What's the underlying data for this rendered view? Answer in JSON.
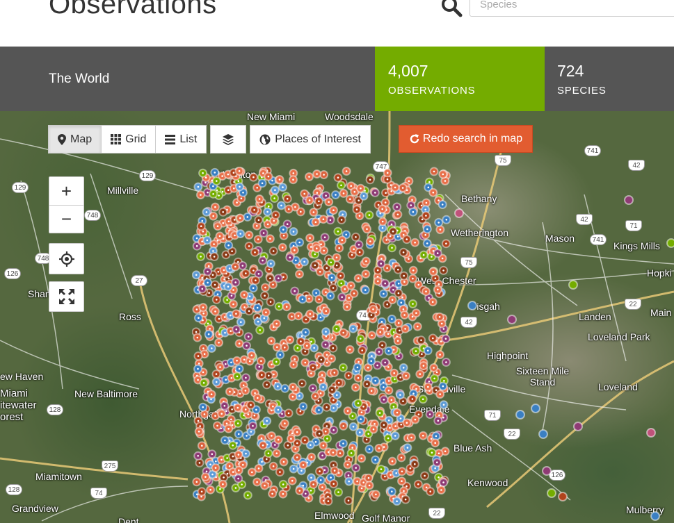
{
  "header": {
    "title": "Observations",
    "search_placeholder": "Species"
  },
  "stats": {
    "place": "The World",
    "observations_count": "4,007",
    "observations_label": "OBSERVATIONS",
    "species_count": "724",
    "species_label": "SPECIES",
    "accent_color": "#74ac00"
  },
  "toolbar": {
    "map_label": "Map",
    "grid_label": "Grid",
    "list_label": "List",
    "places_label": "Places of Interest",
    "redo_label": "Redo search in map",
    "redo_color": "#e25c30"
  },
  "zoom": {
    "in_label": "+",
    "out_label": "−"
  },
  "map": {
    "labels": {
      "new_miami": "New Miami",
      "woodsdale": "Woodsdale",
      "hamilton": "Hamilton",
      "millville": "Millville",
      "bethany": "Bethany",
      "wetherington": "Wetherington",
      "mason": "Mason",
      "kings_mills": "Kings Mills",
      "hopki": "Hopki",
      "shan": "Shan",
      "ross": "Ross",
      "west_chester": "West Chester",
      "pisgah": "Pisgah",
      "landen": "Landen",
      "main": "Main",
      "loveland_park": "Loveland Park",
      "highpoint": "Highpoint",
      "sixteen_mile_stand": "Sixteen Mile Stand",
      "loveland": "Loveland",
      "new_haven": "ew Haven",
      "new_baltimore": "New Baltimore",
      "miami_whitewater": "Miami itewater orest",
      "northgate": "Northgate",
      "sharonville": "Sharonville",
      "evendale": "Evendale",
      "blue_ash": "Blue Ash",
      "kenwood": "Kenwood",
      "miamitown": "Miamitown",
      "grandview": "Grandview",
      "elmwood": "Elmwood",
      "golf_manor": "Golf Manor",
      "mulberry": "Mulberry",
      "dent": "Dent"
    },
    "shields": {
      "s747a": "747",
      "s129a": "129",
      "s129b": "129",
      "s748a": "748",
      "s748b": "748",
      "s126a": "126",
      "s27": "27",
      "s741a": "741",
      "s42a": "42",
      "s42b": "42",
      "s741b": "741",
      "s71a": "71",
      "s75a": "75",
      "s75b": "75",
      "s22a": "22",
      "s42c": "42",
      "s747b": "747",
      "s128a": "128",
      "s275": "275",
      "s128b": "128",
      "s74": "74",
      "s71b": "71",
      "s22b": "22",
      "s126b": "126",
      "s22c": "22"
    }
  }
}
